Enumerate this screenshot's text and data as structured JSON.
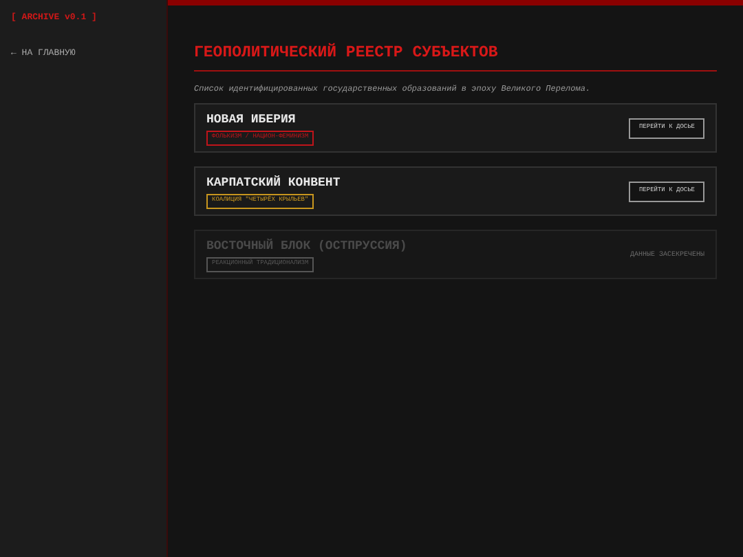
{
  "sidebar": {
    "logo": "[ ARCHIVE v0.1 ]",
    "back_link": "← НА ГЛАВНУЮ"
  },
  "header": {
    "title": "ГЕОПОЛИТИЧЕСКИЙ РЕЕСТР СУБЪЕКТОВ",
    "subtitle": "Список идентифицированных государственных образований в эпоху Великого Перелома."
  },
  "entities": [
    {
      "name": "НОВАЯ ИБЕРИЯ",
      "tag": "ФОЛЬКИЗМ / НАЦИОН-ФЕМИНИЗМ",
      "color": "#c0141a",
      "disabled": false,
      "action": "ПЕРЕЙТИ К ДОСЬЕ"
    },
    {
      "name": "КАРПАТСКИЙ КОНВЕНТ",
      "tag": "КОАЛИЦИЯ \"ЧЕТЫРЁХ КРЫЛЬЕВ\"",
      "color": "#c8961e",
      "disabled": false,
      "action": "ПЕРЕЙТИ К ДОСЬЕ"
    },
    {
      "name": "ВОСТОЧНЫЙ БЛОК (ОСТПРУССИЯ)",
      "tag": "РЕАКЦИОННЫЙ ТРАДИЦИОНАЛИЗМ",
      "color": "#555555",
      "disabled": true,
      "action": "ДАННЫЕ ЗАСЕКРЕЧЕНЫ"
    }
  ]
}
